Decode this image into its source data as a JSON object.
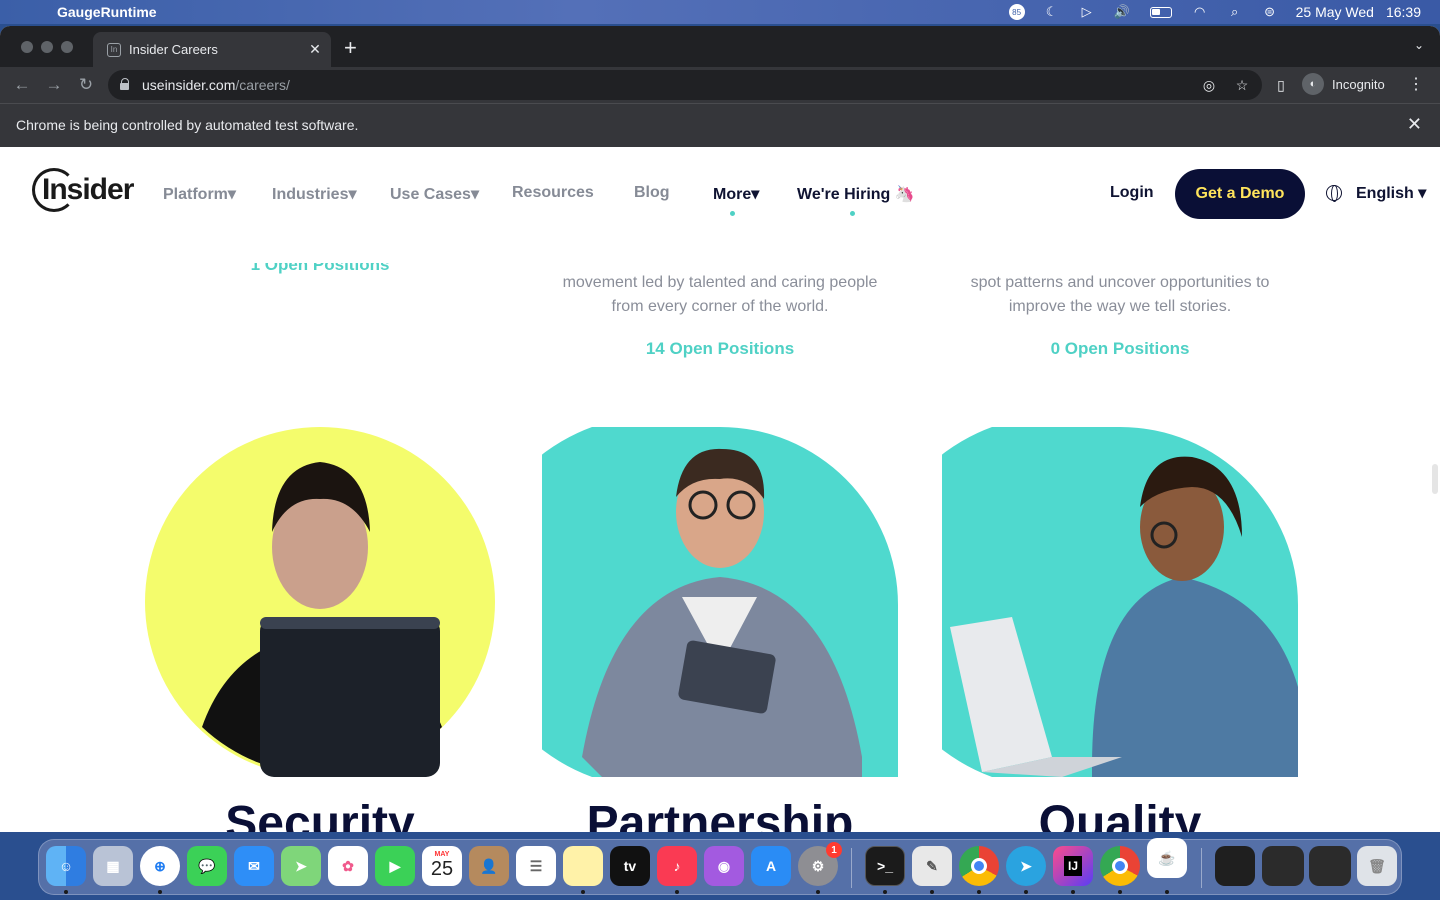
{
  "menubar": {
    "app_name": "GaugeRuntime",
    "date": "25 May Wed",
    "time": "16:39",
    "badge_count": "85"
  },
  "browser": {
    "tab_title": "Insider Careers",
    "url_domain": "useinsider.com",
    "url_path": "/careers/",
    "profile_label": "Incognito",
    "automation_notice": "Chrome is being controlled by automated test software."
  },
  "site": {
    "logo_text": "Insider",
    "nav": [
      {
        "label": "Platform▾"
      },
      {
        "label": "Industries▾"
      },
      {
        "label": "Use Cases▾"
      },
      {
        "label": "Resources"
      },
      {
        "label": "Blog"
      },
      {
        "label": "More▾"
      },
      {
        "label": "We're Hiring 🦄"
      }
    ],
    "login": "Login",
    "cta": "Get a Demo",
    "language": "English ▾"
  },
  "teams": [
    {
      "text_lines": [],
      "positions": "1 Open Positions",
      "title": "Security"
    },
    {
      "text_lines": [
        "movement led by talented and caring people",
        "from every corner of the world."
      ],
      "positions": "14 Open Positions",
      "title": "Partnership"
    },
    {
      "text_lines": [
        "spot patterns and uncover opportunities to",
        "improve the way we tell stories."
      ],
      "positions": "0 Open Positions",
      "title": "Quality"
    }
  ],
  "colors": {
    "accent_teal": "#4fd1c5",
    "navy": "#0a0f36",
    "cta_text": "#ffe45c",
    "yellow_circle": "#f4fc6c"
  },
  "dock": {
    "calendar_month": "MAY",
    "calendar_day": "25",
    "settings_badge": "1"
  }
}
